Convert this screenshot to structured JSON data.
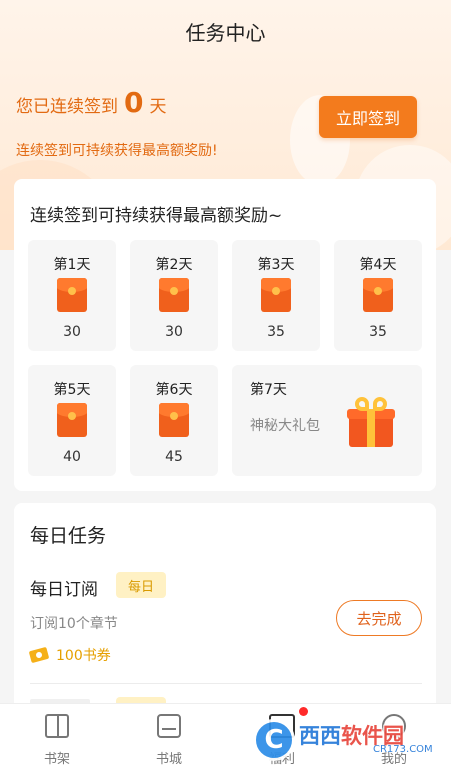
{
  "header": {
    "title": "任务中心"
  },
  "checkin": {
    "streak_prefix": "您已连续签到",
    "streak_days": "0",
    "streak_suffix": "天",
    "subline": "连续签到可持续获得最高额奖励!",
    "button_label": "立即签到"
  },
  "checkin_card": {
    "title": "连续签到可持续获得最高额奖励~",
    "days": [
      {
        "label": "第1天",
        "amount": "30",
        "icon": "red-envelope-icon"
      },
      {
        "label": "第2天",
        "amount": "30",
        "icon": "red-envelope-icon"
      },
      {
        "label": "第3天",
        "amount": "35",
        "icon": "red-envelope-icon"
      },
      {
        "label": "第4天",
        "amount": "35",
        "icon": "red-envelope-icon"
      },
      {
        "label": "第5天",
        "amount": "40",
        "icon": "red-envelope-icon"
      },
      {
        "label": "第6天",
        "amount": "45",
        "icon": "red-envelope-icon"
      }
    ],
    "day7": {
      "label": "第7天",
      "reward": "神秘大礼包",
      "icon": "gift-box-icon"
    }
  },
  "daily_tasks": {
    "title": "每日任务",
    "tasks": [
      {
        "name": "每日订阅",
        "tag": "每日",
        "description": "订阅10个章节",
        "reward": "100书券",
        "button_label": "去完成"
      }
    ]
  },
  "tabbar": {
    "tabs": [
      {
        "label": "书架",
        "icon": "bookshelf-icon"
      },
      {
        "label": "书城",
        "icon": "bookstore-icon"
      },
      {
        "label": "福利",
        "icon": "welfare-gift-icon"
      },
      {
        "label": "我的",
        "icon": "profile-icon"
      }
    ]
  },
  "watermark": {
    "logo_letter": "C",
    "main_a": "西西",
    "main_b": "软件园",
    "sub": "CR173.COM"
  },
  "colors": {
    "accent": "#f37b1d",
    "accent_text": "#e26a12",
    "envelope": "#f0601c",
    "tag_bg": "#fff1c4",
    "notification_dot": "#ff2a2a"
  }
}
